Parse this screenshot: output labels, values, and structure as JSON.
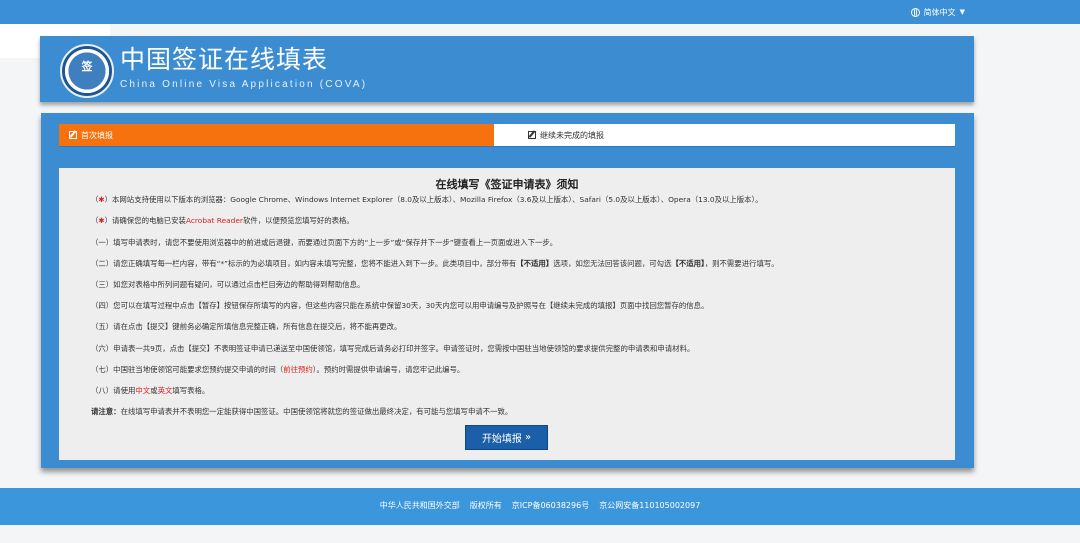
{
  "topbar": {
    "language": "简体中文",
    "language_caret": "▼"
  },
  "header": {
    "logo_text": "签",
    "title": "中国签证在线填表",
    "subtitle": "China Online Visa Application (COVA)"
  },
  "tabs": [
    {
      "label": "首次填报",
      "active": true
    },
    {
      "label": "继续未完成的填报",
      "active": false
    }
  ],
  "notice": {
    "title": "在线填写《签证申请表》须知",
    "items": [
      {
        "prefix": "（",
        "mark": "✱",
        "suffix": "）",
        "text": "本网站支持使用以下版本的浏览器：Google Chrome、Windows Internet Explorer（8.0及以上版本）、Mozilla Firefox（3.6及以上版本）、Safari（5.0及以上版本）、Opera（13.0及以上版本）。"
      },
      {
        "prefix": "（",
        "mark": "✱",
        "suffix": "）",
        "text_before": "请确保您的电脑已安装",
        "link": "Acrobat Reader",
        "text_after": "软件，以便预览您填写好的表格。"
      },
      {
        "text": "（一）填写申请表时，请您不要使用浏览器中的前进或后退键，而要通过页面下方的“上一步”或“保存并下一步”键查看上一页面或进入下一步。"
      },
      {
        "text_before": "（二）请您正确填写每一栏内容，带有“*”标示的为必填项目，如内容未填写完整，您将不能进入到下一步。此类项目中，部分带有",
        "strong1": "【不适用】",
        "text_mid": "选项，如您无法回答该问题，可勾选",
        "strong2": "【不适用】",
        "text_after": "，则不需要进行填写。"
      },
      {
        "text": "（三）如您对表格中所列问题有疑问，可以通过点击栏目旁边的帮助得到帮助信息。"
      },
      {
        "text": "（四）您可以在填写过程中点击【暂存】按钮保存所填写的内容，但这些内容只能在系统中保留30天，30天内您可以用申请编号及护照号在【继续未完成的填报】页面中找回您暂存的信息。"
      },
      {
        "text": "（五）请在点击【提交】键前务必确定所填信息完整正确，所有信息在提交后，将不能再更改。"
      },
      {
        "text": "（六）申请表一共9页，点击【提交】不表明签证申请已递送至中国使领馆，填写完成后请务必打印并签字。申请签证时，您需按中国驻当地使领馆的要求提供完整的申请表和申请材料。"
      },
      {
        "text_before": "（七）中国驻当地使领馆可能要求您预约提交申请的时间（",
        "link": "前往预约",
        "text_after": "）。预约时需提供申请编号，请您牢记此编号。"
      },
      {
        "text_before": "（八）请使用",
        "red1": "中文",
        "text_mid": "或",
        "red2": "英文",
        "text_after": "填写表格。"
      }
    ],
    "note_label": "请注意：",
    "note_text": "在线填写申请表并不表明您一定能获得中国签证。中国使领馆将就您的签证做出最终决定，有可能与您填写申请不一致。"
  },
  "start_button": {
    "label": "开始填报",
    "arrow": "»"
  },
  "footer": {
    "items": [
      "中华人民共和国外交部",
      "版权所有",
      "京ICP备06038296号",
      "京公网安备110105002097"
    ]
  },
  "colors": {
    "primary": "#3c8cd2",
    "accent": "#f5720f",
    "button": "#1b5fa8",
    "required": "#e02020"
  }
}
